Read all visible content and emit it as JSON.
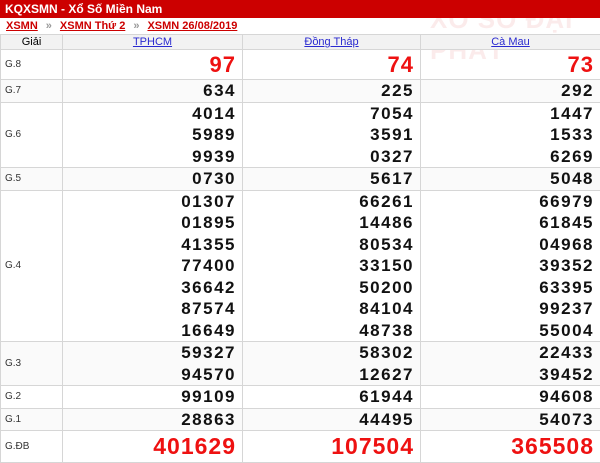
{
  "header": {
    "title": "KQXSMN - Xổ Số Miền Nam"
  },
  "breadcrumb": [
    {
      "label": "XSMN"
    },
    {
      "label": "XSMN Thứ 2"
    },
    {
      "label": "XSMN 26/08/2019"
    }
  ],
  "breadcrumb_sep": "»",
  "watermark": "XỔ SỐ ĐẠI PHÁT",
  "table": {
    "col_label_header": "Giải",
    "provinces": [
      "TPHCM",
      "Đồng Tháp",
      "Cà Mau"
    ],
    "rows": [
      {
        "prize": "G.8",
        "style": "big",
        "values": [
          [
            "97"
          ],
          [
            "74"
          ],
          [
            "73"
          ]
        ]
      },
      {
        "prize": "G.7",
        "style": "line",
        "values": [
          [
            "634"
          ],
          [
            "225"
          ],
          [
            "292"
          ]
        ]
      },
      {
        "prize": "G.6",
        "style": "line",
        "values": [
          [
            "4014",
            "5989",
            "9939"
          ],
          [
            "7054",
            "3591",
            "0327"
          ],
          [
            "1447",
            "1533",
            "6269"
          ]
        ]
      },
      {
        "prize": "G.5",
        "style": "line",
        "values": [
          [
            "0730"
          ],
          [
            "5617"
          ],
          [
            "5048"
          ]
        ]
      },
      {
        "prize": "G.4",
        "style": "line",
        "values": [
          [
            "01307",
            "01895",
            "41355",
            "77400",
            "36642",
            "87574",
            "16649"
          ],
          [
            "66261",
            "14486",
            "80534",
            "33150",
            "50200",
            "84104",
            "48738"
          ],
          [
            "66979",
            "61845",
            "04968",
            "39352",
            "63395",
            "99237",
            "55004"
          ]
        ]
      },
      {
        "prize": "G.3",
        "style": "line",
        "values": [
          [
            "59327",
            "94570"
          ],
          [
            "58302",
            "12627"
          ],
          [
            "22433",
            "39452"
          ]
        ]
      },
      {
        "prize": "G.2",
        "style": "line",
        "values": [
          [
            "99109"
          ],
          [
            "61944"
          ],
          [
            "94608"
          ]
        ]
      },
      {
        "prize": "G.1",
        "style": "line",
        "values": [
          [
            "28863"
          ],
          [
            "44495"
          ],
          [
            "54073"
          ]
        ]
      },
      {
        "prize": "G.ĐB",
        "style": "db",
        "values": [
          [
            "401629"
          ],
          [
            "107504"
          ],
          [
            "365508"
          ]
        ]
      }
    ]
  }
}
